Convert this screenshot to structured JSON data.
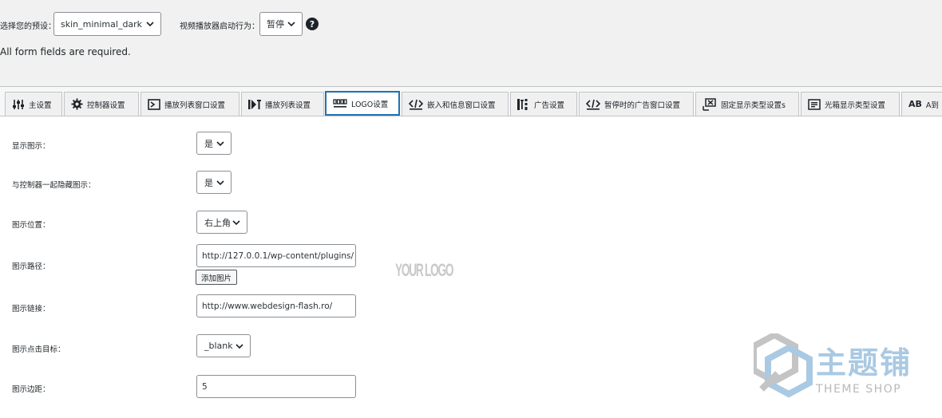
{
  "preset": {
    "label": "选择您的预设：",
    "value": "skin_minimal_dark"
  },
  "startup": {
    "label": "视频播放器启动行为：",
    "value": "暂停"
  },
  "notice": "All form fields are required.",
  "tabs": [
    {
      "label": "主设置",
      "icon": "sliders-icon"
    },
    {
      "label": "控制器设置",
      "icon": "gear-icon"
    },
    {
      "label": "播放列表窗口设置",
      "icon": "playlist-window-icon"
    },
    {
      "label": "播放列表设置",
      "icon": "playlist-icon"
    },
    {
      "label": "LOGO设置",
      "icon": "logo-icon"
    },
    {
      "label": "嵌入和信息窗口设置",
      "icon": "code-icon"
    },
    {
      "label": "广告设置",
      "icon": "ads-icon"
    },
    {
      "label": "暂停时的广告窗口设置",
      "icon": "code-icon"
    },
    {
      "label": "固定显示类型设置s",
      "icon": "fixed-display-icon"
    },
    {
      "label": "光箱显示类型设置",
      "icon": "lightbox-icon"
    },
    {
      "label": "A到",
      "icon": "text-ab-icon"
    }
  ],
  "form": {
    "show_logo": {
      "label": "显示图示：",
      "value": "是"
    },
    "hide_with_controller": {
      "label": "与控制器一起隐藏图示：",
      "value": "是"
    },
    "logo_position": {
      "label": "图示位置：",
      "value": "右上角"
    },
    "logo_path": {
      "label": "图示路径：",
      "value": "http://127.0.0.1/wp-content/plugins/",
      "button": "添加图片",
      "preview": "YOUR LOGO"
    },
    "logo_link": {
      "label": "图示链接：",
      "value": "http://www.webdesign-flash.ro/"
    },
    "logo_target": {
      "label": "图示点击目标：",
      "value": "_blank"
    },
    "logo_margin": {
      "label": "图示边距：",
      "value": "5"
    }
  },
  "watermark": {
    "title": "主题铺",
    "subtitle": "THEME SHOP"
  },
  "colors": {
    "accent": "#2271b1",
    "border": "#8c8f94",
    "watermark_blue": "#aac9e2",
    "watermark_gray": "#b9b9b9"
  }
}
